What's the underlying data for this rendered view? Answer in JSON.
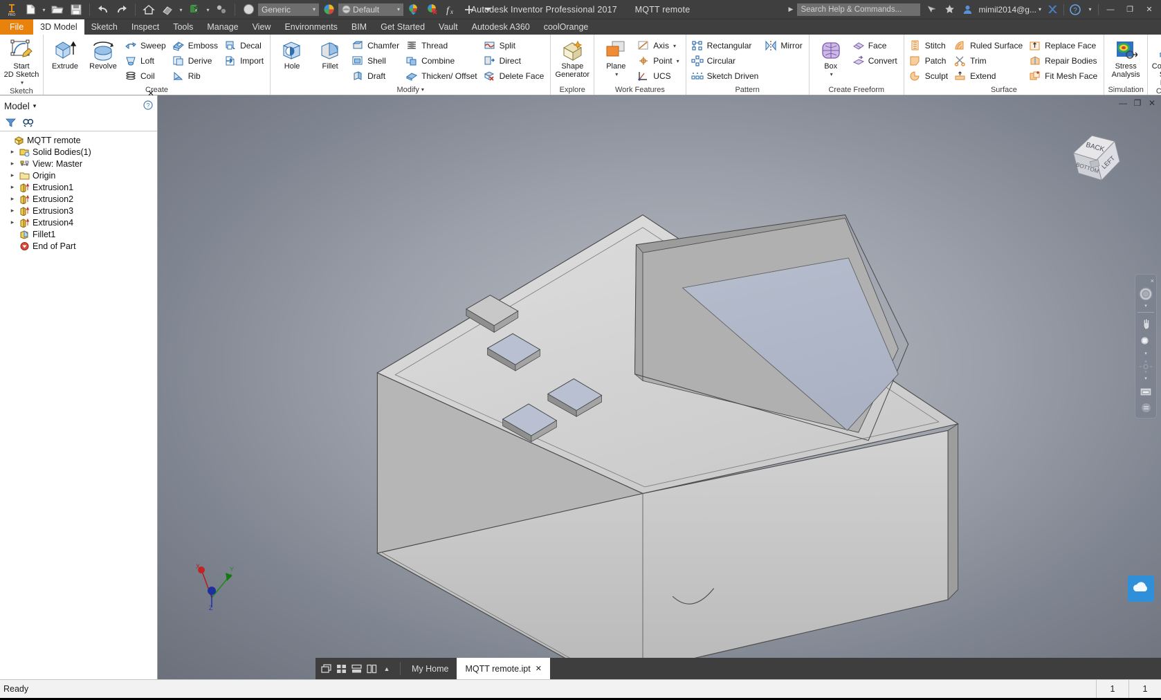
{
  "titlebar": {
    "app_name": "Autodesk Inventor Professional 2017",
    "document_name": "MQTT remote",
    "material_combo": "Generic",
    "appearance_combo": "Default",
    "search_placeholder": "Search Help & Commands...",
    "account": "mimil2014@g...",
    "minimize": "—",
    "restore": "❐",
    "close": "✕",
    "qat": [
      {
        "name": "inventor-pro-logo-icon",
        "label": "PRO"
      },
      {
        "name": "new-file-icon",
        "label": "New"
      },
      {
        "name": "open-file-icon",
        "label": "Open"
      },
      {
        "name": "save-icon",
        "label": "Save"
      },
      {
        "name": "undo-icon",
        "label": "Undo"
      },
      {
        "name": "redo-icon",
        "label": "Redo"
      },
      {
        "name": "home-icon",
        "label": "Home"
      },
      {
        "name": "return-icon",
        "label": "Return"
      },
      {
        "name": "update-icon",
        "label": "Update"
      },
      {
        "name": "select-icon",
        "label": "Select"
      },
      {
        "name": "material-browser-icon",
        "label": "Material"
      },
      {
        "name": "appearance-browser-icon",
        "label": "Appearance"
      },
      {
        "name": "appearance-clear-icon",
        "label": "Clear Appearance Override"
      },
      {
        "name": "parameters-icon",
        "label": "fx"
      },
      {
        "name": "add-to-qat-icon",
        "label": "+"
      },
      {
        "name": "qat-overflow-icon",
        "label": "▾"
      }
    ]
  },
  "ribbon_tabs": [
    {
      "label": "File",
      "kind": "file"
    },
    {
      "label": "3D Model",
      "kind": "active"
    },
    {
      "label": "Sketch",
      "kind": "normal"
    },
    {
      "label": "Inspect",
      "kind": "normal"
    },
    {
      "label": "Tools",
      "kind": "normal"
    },
    {
      "label": "Manage",
      "kind": "normal"
    },
    {
      "label": "View",
      "kind": "normal"
    },
    {
      "label": "Environments",
      "kind": "normal"
    },
    {
      "label": "BIM",
      "kind": "normal"
    },
    {
      "label": "Get Started",
      "kind": "normal"
    },
    {
      "label": "Vault",
      "kind": "normal"
    },
    {
      "label": "Autodesk A360",
      "kind": "normal"
    },
    {
      "label": "coolOrange",
      "kind": "normal"
    }
  ],
  "ribbon_panels": [
    {
      "title": "Sketch",
      "title_caret": false,
      "big": [
        {
          "label": "Start\n2D Sketch",
          "icon": "start-2d-sketch-icon",
          "caret": true
        }
      ],
      "groups": []
    },
    {
      "title": "Create",
      "title_caret": false,
      "big": [
        {
          "label": "Extrude",
          "icon": "extrude-icon",
          "caret": false
        },
        {
          "label": "Revolve",
          "icon": "revolve-icon",
          "caret": false
        }
      ],
      "groups": [
        [
          {
            "label": "Sweep",
            "icon": "sweep-icon"
          },
          {
            "label": "Loft",
            "icon": "loft-icon"
          },
          {
            "label": "Coil",
            "icon": "coil-icon"
          }
        ],
        [
          {
            "label": "Emboss",
            "icon": "emboss-icon"
          },
          {
            "label": "Derive",
            "icon": "derive-icon"
          },
          {
            "label": "Rib",
            "icon": "rib-icon"
          }
        ],
        [
          {
            "label": "Decal",
            "icon": "decal-icon"
          },
          {
            "label": "Import",
            "icon": "import-icon"
          }
        ]
      ]
    },
    {
      "title": "Modify",
      "title_caret": true,
      "big": [
        {
          "label": "Hole",
          "icon": "hole-icon",
          "caret": false
        },
        {
          "label": "Fillet",
          "icon": "fillet-icon",
          "caret": false
        }
      ],
      "groups": [
        [
          {
            "label": "Chamfer",
            "icon": "chamfer-icon"
          },
          {
            "label": "Shell",
            "icon": "shell-icon"
          },
          {
            "label": "Draft",
            "icon": "draft-icon"
          }
        ],
        [
          {
            "label": "Thread",
            "icon": "thread-icon"
          },
          {
            "label": "Combine",
            "icon": "combine-icon"
          },
          {
            "label": "Thicken/ Offset",
            "icon": "thicken-offset-icon"
          }
        ],
        [
          {
            "label": "Split",
            "icon": "split-icon"
          },
          {
            "label": "Direct",
            "icon": "direct-icon"
          },
          {
            "label": "Delete Face",
            "icon": "delete-face-icon"
          }
        ]
      ]
    },
    {
      "title": "Explore",
      "title_caret": false,
      "big": [
        {
          "label": "Shape\nGenerator",
          "icon": "shape-generator-icon",
          "caret": false
        }
      ],
      "groups": []
    },
    {
      "title": "Work Features",
      "title_caret": false,
      "big": [
        {
          "label": "Plane",
          "icon": "work-plane-icon",
          "caret": true
        }
      ],
      "groups": [
        [
          {
            "label": "Axis",
            "icon": "work-axis-icon",
            "caret": true
          },
          {
            "label": "Point",
            "icon": "work-point-icon",
            "caret": true
          },
          {
            "label": "UCS",
            "icon": "ucs-icon"
          }
        ]
      ]
    },
    {
      "title": "Pattern",
      "title_caret": false,
      "big": [],
      "groups": [
        [
          {
            "label": "Rectangular",
            "icon": "rectangular-pattern-icon"
          },
          {
            "label": "Circular",
            "icon": "circular-pattern-icon"
          },
          {
            "label": "Sketch Driven",
            "icon": "sketch-driven-pattern-icon"
          }
        ],
        [
          {
            "label": "Mirror",
            "icon": "mirror-icon"
          }
        ]
      ]
    },
    {
      "title": "Create Freeform",
      "title_caret": false,
      "big": [
        {
          "label": "Box",
          "icon": "freeform-box-icon",
          "caret": true
        }
      ],
      "groups": [
        [
          {
            "label": "Face",
            "icon": "freeform-face-icon"
          },
          {
            "label": "Convert",
            "icon": "freeform-convert-icon"
          }
        ]
      ]
    },
    {
      "title": "Surface",
      "title_caret": false,
      "big": [],
      "groups": [
        [
          {
            "label": "Stitch",
            "icon": "stitch-icon"
          },
          {
            "label": "Patch",
            "icon": "patch-icon"
          },
          {
            "label": "Sculpt",
            "icon": "sculpt-icon"
          }
        ],
        [
          {
            "label": "Ruled Surface",
            "icon": "ruled-surface-icon"
          },
          {
            "label": "Trim",
            "icon": "trim-icon"
          },
          {
            "label": "Extend",
            "icon": "extend-icon"
          }
        ],
        [
          {
            "label": "Replace Face",
            "icon": "replace-face-icon"
          },
          {
            "label": "Repair Bodies",
            "icon": "repair-bodies-icon"
          },
          {
            "label": "Fit Mesh Face",
            "icon": "fit-mesh-face-icon"
          }
        ]
      ]
    },
    {
      "title": "Simulation",
      "title_caret": false,
      "big": [
        {
          "label": "Stress\nAnalysis",
          "icon": "stress-analysis-icon",
          "caret": false
        }
      ],
      "groups": []
    },
    {
      "title": "Convert",
      "title_caret": false,
      "big": [
        {
          "label": "Convert to\nSheet Metal",
          "icon": "convert-to-sheet-metal-icon",
          "caret": false
        }
      ],
      "groups": []
    }
  ],
  "ribbon_overflow": {
    "help_icon": "ribbon-help-icon",
    "caret": "▾"
  },
  "browser": {
    "title": "Model",
    "title_caret": "▾",
    "help_icon": "browser-help-icon",
    "close_icon": "✕",
    "filter_icon": "filter-icon",
    "find_icon": "find-icon",
    "tree": [
      {
        "label": "MQTT remote",
        "icon": "part-document-icon",
        "expand": "",
        "indent": 0
      },
      {
        "label": "Solid Bodies(1)",
        "icon": "solid-bodies-icon",
        "expand": "▸",
        "indent": 1
      },
      {
        "label": "View: Master",
        "icon": "view-master-icon",
        "expand": "▸",
        "indent": 1
      },
      {
        "label": "Origin",
        "icon": "origin-folder-icon",
        "expand": "▸",
        "indent": 1
      },
      {
        "label": "Extrusion1",
        "icon": "extrusion-icon",
        "expand": "▸",
        "indent": 1
      },
      {
        "label": "Extrusion2",
        "icon": "extrusion-icon",
        "expand": "▸",
        "indent": 1
      },
      {
        "label": "Extrusion3",
        "icon": "extrusion-icon",
        "expand": "▸",
        "indent": 1
      },
      {
        "label": "Extrusion4",
        "icon": "extrusion-icon",
        "expand": "▸",
        "indent": 1
      },
      {
        "label": "Fillet1",
        "icon": "fillet-feature-icon",
        "expand": "",
        "indent": 1
      },
      {
        "label": "End of Part",
        "icon": "end-of-part-icon",
        "expand": "",
        "indent": 1
      }
    ]
  },
  "viewport": {
    "minimize": "—",
    "restore": "❐",
    "close": "✕",
    "viewcube_faces": {
      "top": "BACK",
      "left": "BOTTOM",
      "right": "LEFT"
    },
    "axis_labels": {
      "x": "X",
      "y": "Y",
      "z": "Z"
    },
    "navbar": {
      "close": "×",
      "items": [
        {
          "name": "full-navigation-wheel-icon",
          "caret": true
        },
        {
          "name": "pan-icon",
          "caret": false
        },
        {
          "name": "zoom-icon",
          "caret": true
        },
        {
          "name": "orbit-icon",
          "caret": true
        },
        {
          "name": "look-at-icon",
          "caret": false
        }
      ],
      "customize_icon": "navbar-customize-icon"
    }
  },
  "tabbar": {
    "view_buttons": [
      {
        "name": "cascade-windows-icon",
        "label": "Cascade"
      },
      {
        "name": "tile-windows-icon",
        "label": "Tile"
      },
      {
        "name": "tile-horizontal-icon",
        "label": "Tile Horizontally"
      },
      {
        "name": "tile-vertical-icon",
        "label": "Tile Vertically"
      },
      {
        "name": "tabbar-expand-icon",
        "label": "▲"
      }
    ],
    "tabs": [
      {
        "label": "My Home",
        "active": false,
        "closable": false
      },
      {
        "label": "MQTT remote.ipt",
        "active": true,
        "closable": true,
        "close": "✕"
      }
    ]
  },
  "statusbar": {
    "message": "Ready",
    "cell1": "1",
    "cell2": "1"
  }
}
